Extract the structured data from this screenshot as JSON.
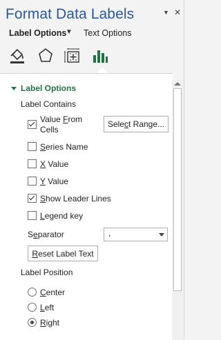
{
  "pane": {
    "title": "Format Data Labels",
    "close_glyph": "✕",
    "menu_glyph": "▼"
  },
  "tabs": {
    "label_options": "Label Options",
    "text_options": "Text Options"
  },
  "icons": [
    "fill-line-icon",
    "effects-icon",
    "size-properties-icon",
    "label-options-icon"
  ],
  "accent_color": "#217346",
  "title_color": "#2b579a",
  "section": {
    "title": "Label Options",
    "contains_header": "Label Contains",
    "value_from_cells": "Value From Cells",
    "value_from_cells_line1": "Value From",
    "value_from_cells_line2": "Cells",
    "select_range_label": "Select Range...",
    "series_name": "Series Name",
    "x_value": "X Value",
    "y_value": "Y Value",
    "show_leader_lines": "Show Leader Lines",
    "legend_key": "Legend key",
    "separator_label": "Separator",
    "separator_value": ",",
    "reset_label": "Reset Label Text",
    "position_header": "Label Position",
    "pos_center": "Center",
    "pos_left": "Left",
    "pos_right": "Right"
  },
  "checks": {
    "value_from_cells": true,
    "series_name": false,
    "x_value": false,
    "y_value": false,
    "show_leader_lines": true,
    "legend_key": false
  },
  "position_selected": "Right"
}
